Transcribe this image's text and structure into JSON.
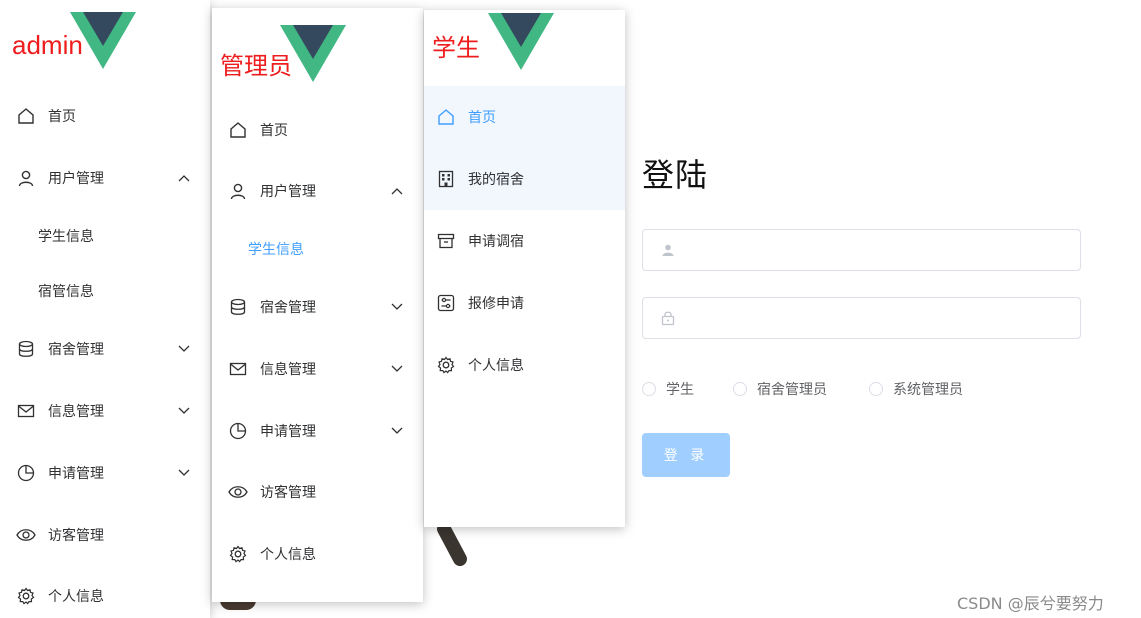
{
  "admin_panel": {
    "title": "admin",
    "menu": {
      "home": "首页",
      "user_mgmt": "用户管理",
      "student_info": "学生信息",
      "dorm_admin_info": "宿管信息",
      "dorm_mgmt": "宿舍管理",
      "info_mgmt": "信息管理",
      "apply_mgmt": "申请管理",
      "visitor_mgmt": "访客管理",
      "personal_info": "个人信息"
    }
  },
  "manager_panel": {
    "title": "管理员",
    "menu": {
      "home": "首页",
      "user_mgmt": "用户管理",
      "student_info": "学生信息",
      "dorm_mgmt": "宿舍管理",
      "info_mgmt": "信息管理",
      "apply_mgmt": "申请管理",
      "visitor_mgmt": "访客管理",
      "personal_info": "个人信息"
    }
  },
  "student_panel": {
    "title": "学生",
    "menu": {
      "home": "首页",
      "my_dorm": "我的宿舍",
      "apply_change": "申请调宿",
      "repair_apply": "报修申请",
      "personal_info": "个人信息"
    }
  },
  "login": {
    "title": "登陆",
    "username_value": "",
    "password_value": "",
    "roles": [
      "学生",
      "宿舍管理员",
      "系统管理员"
    ],
    "submit_label": "登 录"
  },
  "colors": {
    "accent": "#409eff",
    "title_red": "#ee1c1c",
    "button_disabled": "#a0cfff"
  },
  "watermark": "CSDN @辰兮要努力"
}
